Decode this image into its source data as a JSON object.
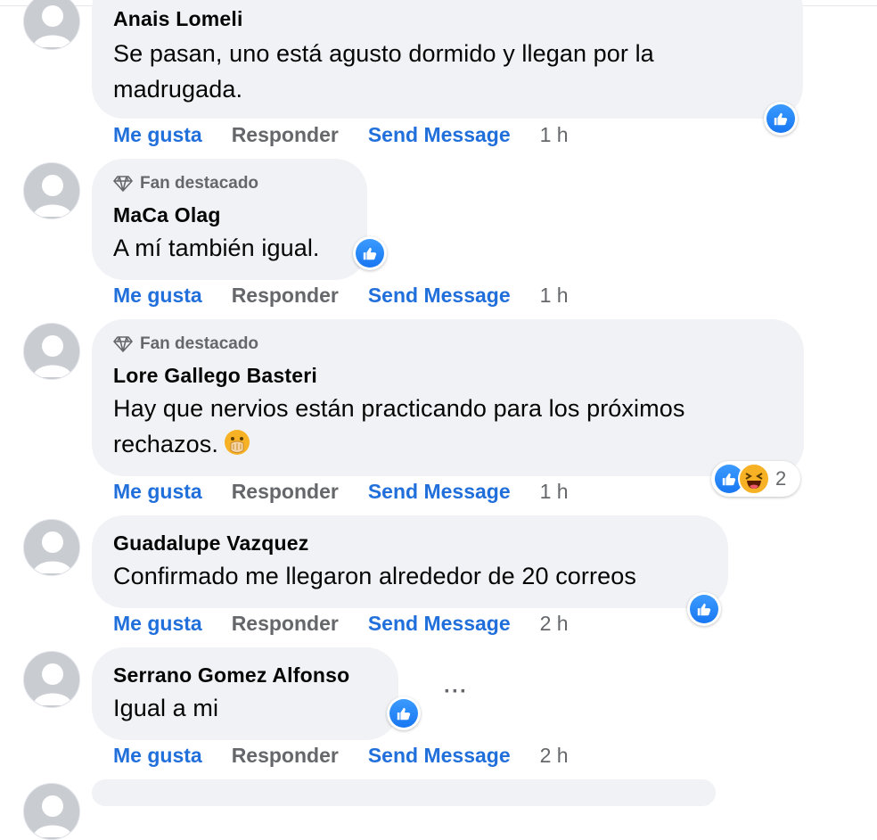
{
  "comments": [
    {
      "author": "Anais Lomeli",
      "text_lines": [
        "Se pasan, uno está agusto dormido y llegan por la",
        "madrugada."
      ],
      "badge": "",
      "actions": {
        "like": "Me gusta",
        "reply": "Responder",
        "send": "Send Message",
        "time": "1 h"
      },
      "reaction_icon": "like-icon"
    },
    {
      "author": "MaCa Olag",
      "text_lines": [
        "A mí también igual."
      ],
      "badge": "Fan destacado",
      "actions": {
        "like": "Me gusta",
        "reply": "Responder",
        "send": "Send Message",
        "time": "1 h"
      },
      "reaction_icon": "like-icon"
    },
    {
      "author": "Lore Gallego Basteri",
      "text_lines": [
        "Hay que nervios están practicando para los próximos",
        "rechazos."
      ],
      "badge": "Fan destacado",
      "emoji": "hand-over-mouth-emoji",
      "actions": {
        "like": "Me gusta",
        "reply": "Responder",
        "send": "Send Message",
        "time": "1 h"
      },
      "reactions": {
        "icons": [
          "like-icon",
          "haha-icon"
        ],
        "count": "2"
      }
    },
    {
      "author": "Guadalupe Vazquez",
      "text_lines": [
        "Confirmado me llegaron alrededor de 20 correos"
      ],
      "badge": "",
      "actions": {
        "like": "Me gusta",
        "reply": "Responder",
        "send": "Send Message",
        "time": "2 h"
      },
      "reaction_icon": "like-icon"
    },
    {
      "author": "Serrano Gomez Alfonso",
      "text_lines": [
        "Igual a mi"
      ],
      "badge": "",
      "more_label": "···",
      "actions": {
        "like": "Me gusta",
        "reply": "Responder",
        "send": "Send Message",
        "time": "2 h"
      },
      "reaction_icon": "like-icon"
    }
  ],
  "colors": {
    "bubble": "#f0f2f5",
    "link": "#216fdb",
    "muted": "#65676b",
    "like_blue": "#1877f2"
  }
}
